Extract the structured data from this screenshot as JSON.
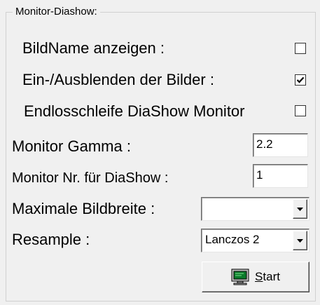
{
  "group": {
    "title": "Monitor-Diashow:"
  },
  "checkboxes": [
    {
      "label": "BildName anzeigen :",
      "checked": false
    },
    {
      "label": "Ein-/Ausblenden der Bilder :",
      "checked": true
    },
    {
      "label": "Endlosschleife DiaShow Monitor",
      "checked": false
    }
  ],
  "fields": {
    "gamma": {
      "label": "Monitor Gamma :",
      "value": "2.2"
    },
    "monitor_nr": {
      "label": "Monitor Nr. für DiaShow :",
      "value": "1"
    },
    "max_width": {
      "label": "Maximale Bildbreite :",
      "value": ""
    },
    "resample": {
      "label": "Resample :",
      "value": "Lanczos 2"
    }
  },
  "start_button": {
    "accel": "S",
    "rest": "tart",
    "icon": "monitor-icon"
  }
}
